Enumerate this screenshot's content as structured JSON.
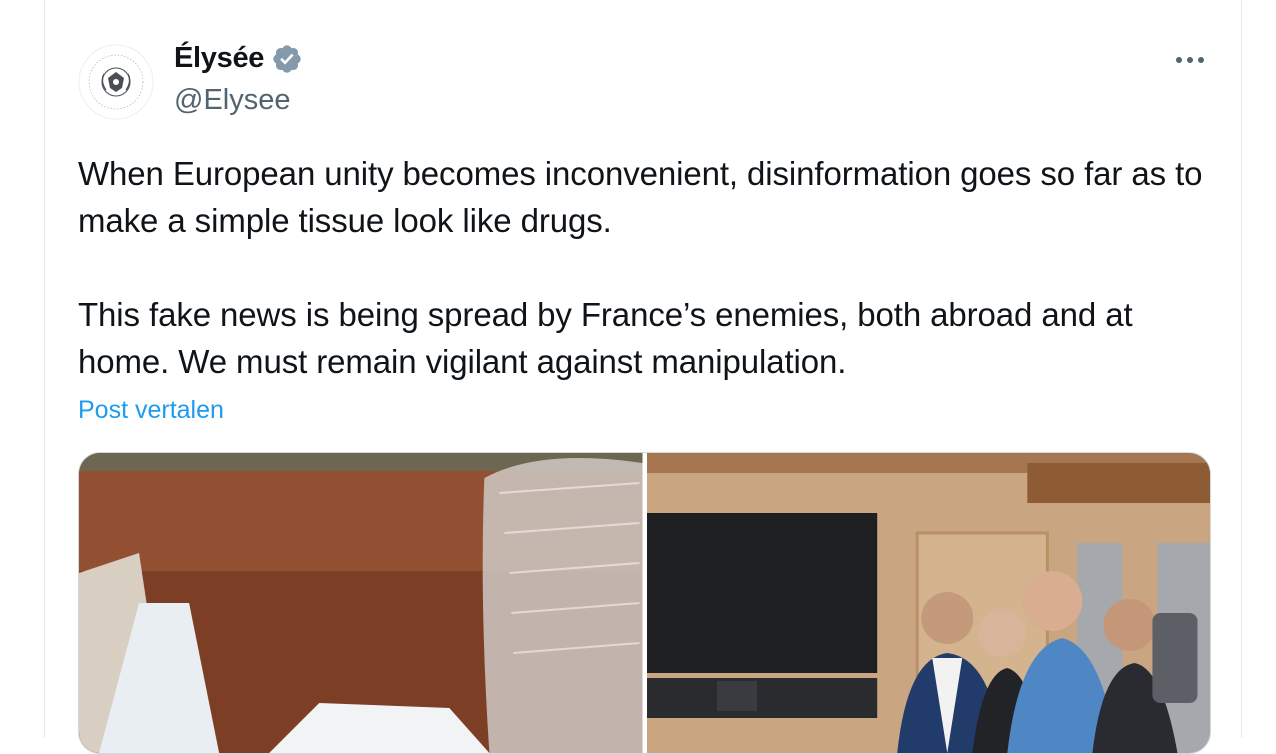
{
  "tweet": {
    "display_name": "Élysée",
    "handle": "@Elysee",
    "verified_icon": "verified-badge-icon",
    "more_icon": "more-dots-icon",
    "paragraph_1": "When European unity becomes inconvenient, disinformation goes so far as to make a simple tissue look like drugs.",
    "paragraph_2": "This fake news is being spread by France’s enemies, both abroad and at home. We must remain vigilant against manipulation.",
    "translate_label": "Post vertalen",
    "colors": {
      "link": "#1d9bf0",
      "handle": "#536471",
      "verified": "#829aab",
      "border": "#cfd9de"
    }
  }
}
